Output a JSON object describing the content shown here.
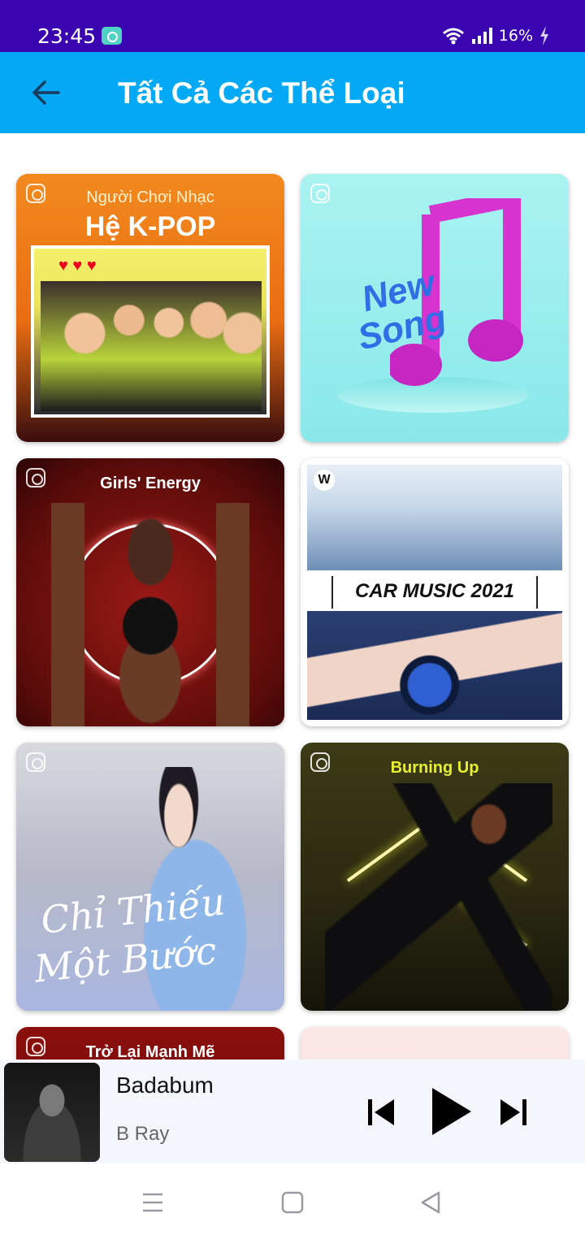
{
  "status_bar": {
    "time": "23:45",
    "battery": "16%"
  },
  "header": {
    "title": "Tất Cả Các Thể Loại",
    "back_icon": "arrow-left-icon"
  },
  "genres": [
    {
      "caption_small": "Người Chơi Nhạc",
      "caption_big": "Hệ K-POP"
    },
    {
      "caption_small": "New",
      "caption_big": "Song"
    },
    {
      "caption_small": "Girls' Energy"
    },
    {
      "caption_small": "W",
      "caption_big": "CAR MUSIC 2021"
    },
    {
      "caption_small": "Chỉ Thiếu",
      "caption_big": "Một Bước"
    },
    {
      "caption_small": "Burning Up"
    },
    {
      "caption_small": "Trở Lại Mạnh Mẽ"
    },
    {
      "caption_small": ""
    }
  ],
  "mini_player": {
    "song_title": "Badabum",
    "artist": "B Ray"
  },
  "colors": {
    "status_bar": "#3a05b0",
    "app_bar": "#03a9f4"
  }
}
